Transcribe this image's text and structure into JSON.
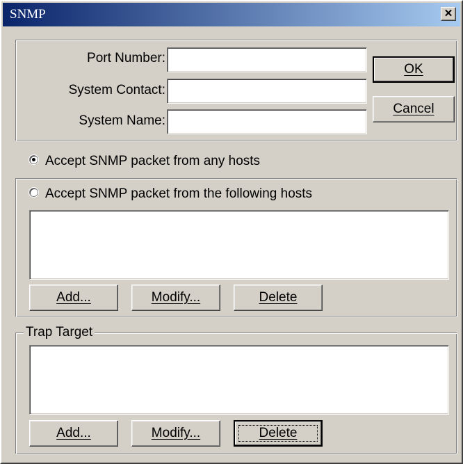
{
  "window": {
    "title": "SNMP",
    "close_glyph": "✕"
  },
  "settings": {
    "port_label": "Port Number:",
    "port_value": "",
    "contact_label": "System Contact:",
    "contact_value": "",
    "name_label": "System Name:",
    "name_value": ""
  },
  "dialog_buttons": {
    "ok": "OK",
    "cancel": "Cancel"
  },
  "access": {
    "any_hosts_label": "Accept SNMP packet from any hosts",
    "any_hosts_selected": true,
    "following_hosts_label": "Accept SNMP packet from the following hosts",
    "following_hosts_selected": false,
    "hosts": [],
    "add": "Add...",
    "modify": "Modify...",
    "delete": "Delete"
  },
  "trap": {
    "legend": "Trap Target",
    "targets": [],
    "add": "Add...",
    "modify": "Modify...",
    "delete": "Delete"
  },
  "colors": {
    "titlebar_start": "#0a246a",
    "titlebar_end": "#a6caf0",
    "face": "#d4d0c8"
  }
}
